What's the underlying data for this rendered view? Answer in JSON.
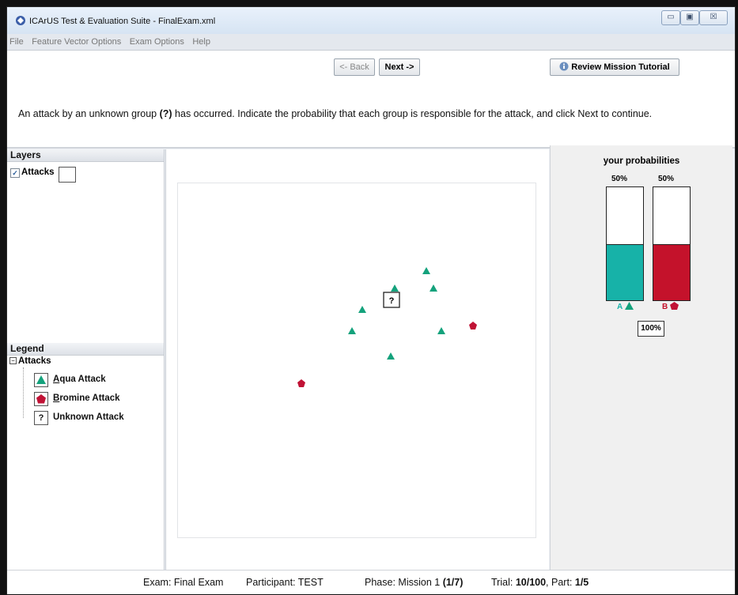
{
  "window": {
    "title": "ICArUS Test & Evaluation Suite - FinalExam.xml",
    "controls": [
      "▭",
      "▣",
      "☒"
    ]
  },
  "menu": [
    "File",
    "Feature Vector Options",
    "Exam Options",
    "Help"
  ],
  "toolbar": {
    "back_label": "<- Back",
    "next_label": "Next ->",
    "tutorial_label": "Review Mission Tutorial"
  },
  "instructions": {
    "before": "An attack by an unknown group ",
    "bold": "(?)",
    "after": " has occurred. Indicate the probability that each group is responsible for the attack, and click Next to continue."
  },
  "layers": {
    "header": "Layers",
    "items": [
      {
        "label": "Attacks",
        "checked": true
      }
    ]
  },
  "legend": {
    "header": "Legend",
    "group": "Attacks",
    "items": [
      {
        "mnemonic": "A",
        "rest": "qua Attack",
        "icon": "triangle-icon",
        "color": "#14a27c"
      },
      {
        "mnemonic": "B",
        "rest": "romine Attack",
        "icon": "pentagon-icon",
        "color": "#c01235"
      },
      {
        "mnemonic": "",
        "rest": "Unknown Attack",
        "icon": "question-icon",
        "color": "#000000"
      }
    ]
  },
  "probabilities": {
    "title": "your probabilities",
    "groups": [
      {
        "letter": "A",
        "pct_label": "50%",
        "value": 0.5,
        "color": "#17b2a8"
      },
      {
        "letter": "B",
        "pct_label": "50%",
        "value": 0.5,
        "color": "#c4122b"
      }
    ],
    "total_label": "100%"
  },
  "map": {
    "unknown_label": "?"
  },
  "status": {
    "exam_label": "Exam:",
    "exam_value": "Final Exam",
    "participant_label": "Participant:",
    "participant_value": "TEST",
    "phase_label": "Phase:",
    "phase_value": "Mission 1",
    "phase_bold": "(1/7)",
    "trial_label": "Trial:",
    "trial_value": "10/100",
    "part_label": ", Part:",
    "part_value": "1/5"
  },
  "colors": {
    "aqua": "#14a27c",
    "bromine": "#c01235"
  }
}
